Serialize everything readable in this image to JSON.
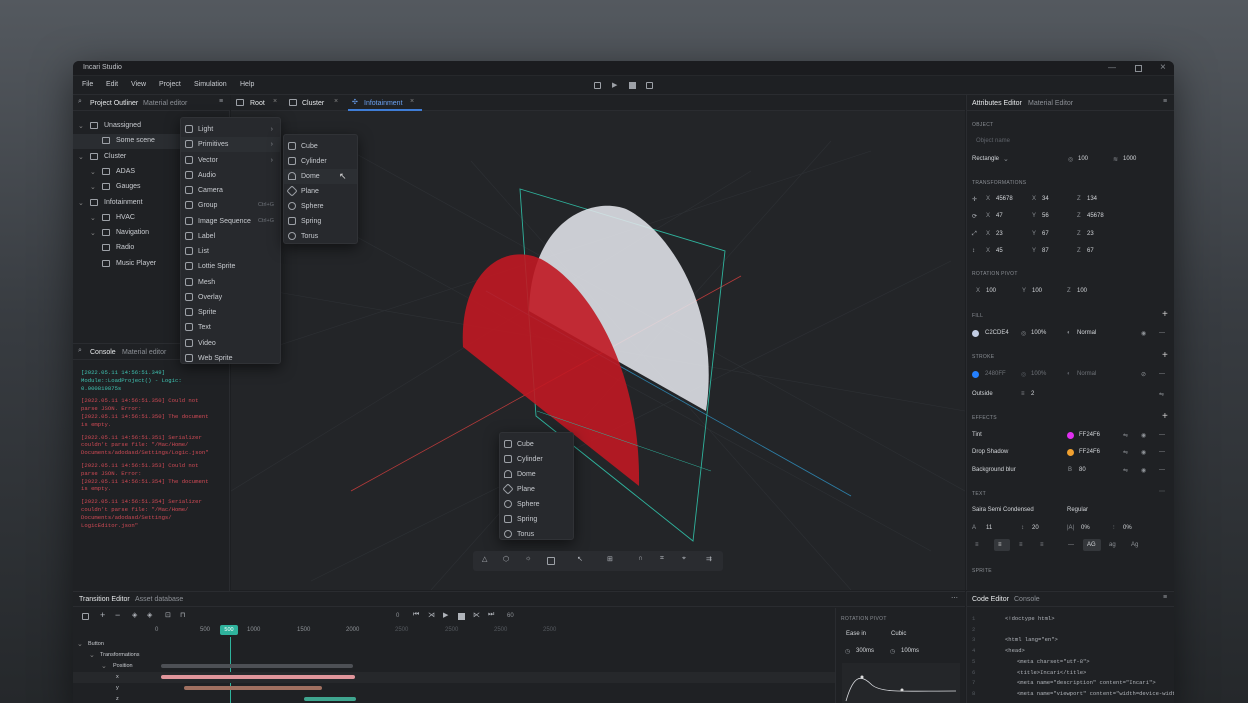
{
  "app": {
    "title": "Incari Studio"
  },
  "menu": [
    "File",
    "Edit",
    "View",
    "Project",
    "Simulation",
    "Help"
  ],
  "outliner": {
    "tabs": [
      "Project Outliner",
      "Material editor"
    ],
    "items": [
      "Unassigned",
      "Some scene",
      "Cluster",
      "ADAS",
      "Gauges",
      "Infotainment",
      "HVAC",
      "Navigation",
      "Radio",
      "Music Player"
    ]
  },
  "scene_tabs": [
    "Root",
    "Cluster",
    "Infotainment"
  ],
  "context_menu": [
    {
      "label": "Light",
      "shortcut": "",
      "arrow": "›"
    },
    {
      "label": "Primitives",
      "shortcut": "",
      "arrow": "›"
    },
    {
      "label": "Vector",
      "shortcut": "",
      "arrow": "›"
    },
    {
      "label": "Audio",
      "shortcut": "",
      "arrow": ""
    },
    {
      "label": "Camera",
      "shortcut": "",
      "arrow": ""
    },
    {
      "label": "Group",
      "shortcut": "Ctrl+G",
      "arrow": ""
    },
    {
      "label": "Image Sequence",
      "shortcut": "Ctrl+G",
      "arrow": ""
    },
    {
      "label": "Label",
      "shortcut": "",
      "arrow": ""
    },
    {
      "label": "List",
      "shortcut": "",
      "arrow": ""
    },
    {
      "label": "Lottie Sprite",
      "shortcut": "",
      "arrow": ""
    },
    {
      "label": "Mesh",
      "shortcut": "",
      "arrow": ""
    },
    {
      "label": "Overlay",
      "shortcut": "",
      "arrow": ""
    },
    {
      "label": "Sprite",
      "shortcut": "",
      "arrow": ""
    },
    {
      "label": "Text",
      "shortcut": "",
      "arrow": ""
    },
    {
      "label": "Video",
      "shortcut": "",
      "arrow": ""
    },
    {
      "label": "Web Sprite",
      "shortcut": "",
      "arrow": ""
    }
  ],
  "primitives": [
    "Cube",
    "Cylinder",
    "Dome",
    "Plane",
    "Sphere",
    "Spring",
    "Torus"
  ],
  "console": {
    "tabs": [
      "Console",
      "Material editor"
    ],
    "lines": [
      "[2022.05.11 14:56:51.349]",
      "Module::LoadProject() - Logic:",
      "0.000819875s",
      "",
      "[2022.05.11 14:56:51.350] Could not",
      "parse JSON. Error:",
      "[2022.05.11 14:56:51.350] The document",
      "is empty.",
      "",
      "[2022.05.11 14:56:51.351] Serializer",
      "couldn't parse file: \"/Mac/Home/",
      "Documents/adodasd/Settings/Logic.json\"",
      "",
      "[2022.05.11 14:56:51.353] Could not",
      "parse JSON. Error:",
      "[2022.05.11 14:56:51.354] The document",
      "is empty.",
      "",
      "[2022.05.11 14:56:51.354] Serializer",
      "couldn't parse file: \"/Mac/Home/",
      "Documents/adodasd/Settings/",
      "LogicEditor.json\""
    ]
  },
  "attributes": {
    "tabs": [
      "Attributes Editor",
      "Material Editor"
    ],
    "object_section": "OBJECT",
    "object_placeholder": "Object name",
    "object_type": "Rectangle",
    "object_v1": "100",
    "object_v2": "1000",
    "transformations_section": "TRANSFORMATIONS",
    "transform_rows": [
      {
        "x": "45678",
        "y": "34",
        "z": "134"
      },
      {
        "x": "47",
        "y": "56",
        "z": "45678"
      },
      {
        "x": "23",
        "y": "67",
        "z": "23"
      },
      {
        "x": "45",
        "y": "87",
        "z": "67"
      }
    ],
    "pivot_section": "ROTATION PIVOT",
    "pivot": {
      "x": "100",
      "y": "100",
      "z": "100"
    },
    "fill_section": "FILL",
    "fill": {
      "color": "C2CDE4",
      "opacity": "100%",
      "mode": "Normal"
    },
    "stroke_section": "STROKE",
    "stroke": {
      "color": "2480FF",
      "opacity": "100%",
      "mode": "Normal",
      "position": "Outside",
      "width": "2"
    },
    "effects_section": "EFFECTS",
    "effects": [
      {
        "name": "Tint",
        "value": "FF24F6",
        "swatch": "#e02ff0"
      },
      {
        "name": "Drop Shadow",
        "value": "FF24F6",
        "swatch": "#f0a02f"
      },
      {
        "name": "Background blur",
        "value": "80",
        "swatch": ""
      }
    ],
    "text_section": "TEXT",
    "font": "Saira Semi Condensed",
    "weight": "Regular",
    "text_vals": [
      "11",
      "20",
      "0%",
      "0%"
    ],
    "case_opts": [
      "—",
      "AG",
      "ag",
      "Ag"
    ],
    "sprite_section": "SPRITE",
    "labels": {
      "x": "X",
      "y": "Y",
      "z": "Z",
      "b": "B"
    }
  },
  "timeline": {
    "tabs": [
      "Transition Editor",
      "Asset database"
    ],
    "ticks": [
      "0",
      "500",
      "500",
      "1000",
      "1500",
      "2000",
      "2500",
      "2500",
      "2500",
      "2500"
    ],
    "frame_start": "0",
    "frame_end": "60",
    "tree": [
      "Button",
      "Transformations",
      "Position",
      "x",
      "y",
      "z"
    ],
    "pivot_title": "ROTATION PIVOT",
    "ease": "Ease in",
    "curve": "Cubic",
    "dur1": "300ms",
    "dur2": "100ms"
  },
  "code": {
    "tabs": [
      "Code Editor",
      "Console"
    ],
    "lines": [
      "<!doctype html>",
      "",
      "<html lang=\"en\">",
      "<head>",
      "<meta charset=\"utf-8\">",
      "<title>Incari</title>",
      "<meta name=\"description\" content=\"Incari\">",
      "<meta name=\"viewport\" content=\"width=device-width, initial-"
    ]
  },
  "colors": {
    "accent": "#2fb39d",
    "danger": "#c01822",
    "window_bg": "#1d1f22"
  }
}
